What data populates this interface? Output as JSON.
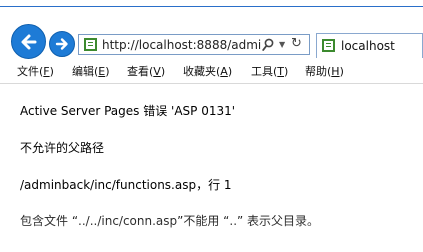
{
  "browser": {
    "address": "http://localhost:8888/admi",
    "tab_title": "localhost"
  },
  "menu": {
    "items": [
      {
        "text": "文件(",
        "key": "F",
        "close": ")"
      },
      {
        "text": "编辑(",
        "key": "E",
        "close": ")"
      },
      {
        "text": "查看(",
        "key": "V",
        "close": ")"
      },
      {
        "text": "收藏夹(",
        "key": "A",
        "close": ")"
      },
      {
        "text": "工具(",
        "key": "T",
        "close": ")"
      },
      {
        "text": "帮助(",
        "key": "H",
        "close": ")"
      }
    ]
  },
  "page": {
    "error_title": "Active Server Pages  错误  'ASP 0131'",
    "error_message": "不允许的父路径",
    "error_location": "/adminback/inc/functions.asp，行 1",
    "error_detail": "包含文件 “../../inc/conn.asp”不能用 “..” 表示父目录。"
  },
  "colors": {
    "nav_button": "#1e7bd6",
    "page_icon": "#3c8a2e",
    "accent_line": "#2a6fc9"
  }
}
